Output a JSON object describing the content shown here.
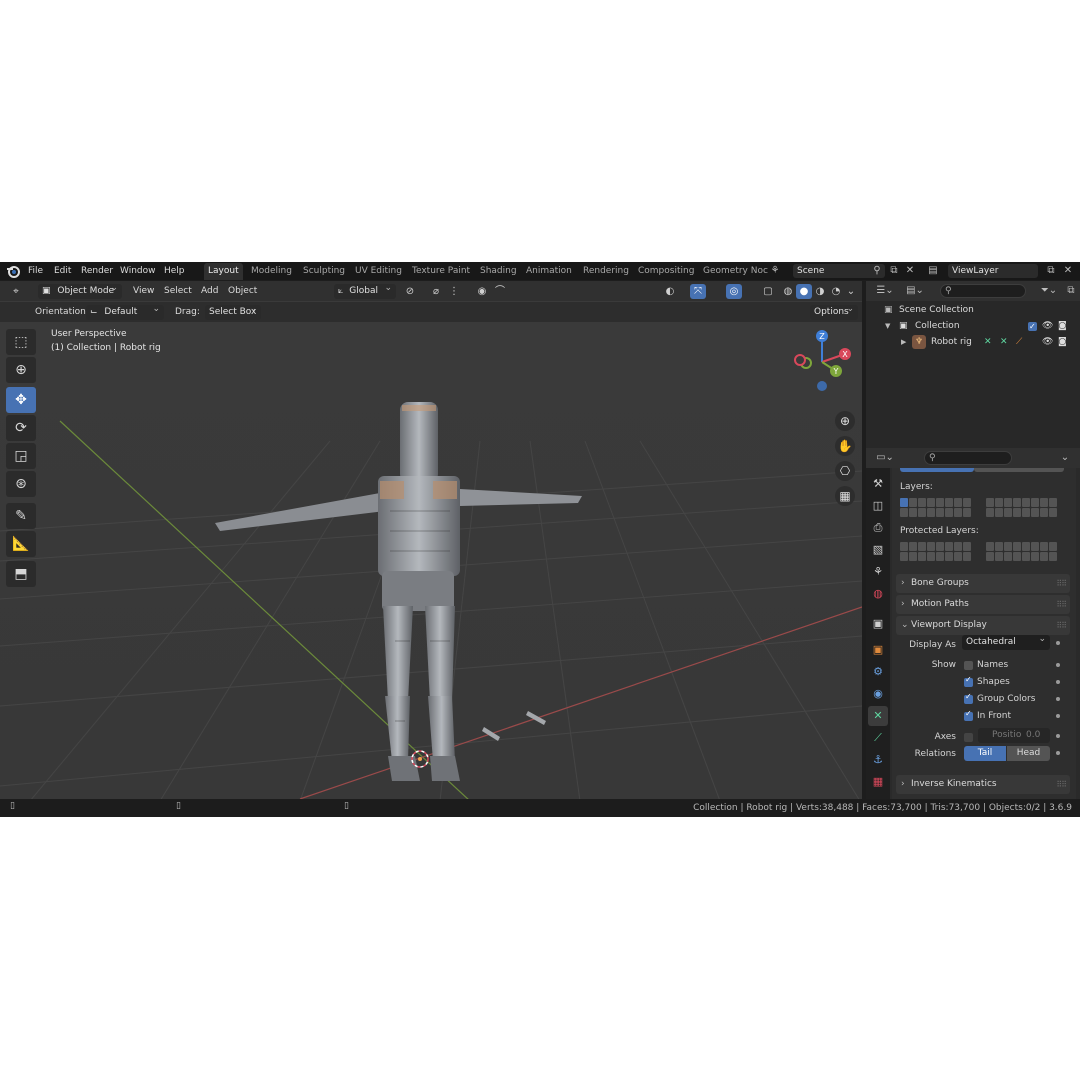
{
  "menu": {
    "items": [
      "File",
      "Edit",
      "Render",
      "Window",
      "Help"
    ]
  },
  "workspaces": {
    "tabs": [
      "Layout",
      "Modeling",
      "Sculpting",
      "UV Editing",
      "Texture Paint",
      "Shading",
      "Animation",
      "Rendering",
      "Compositing",
      "Geometry Noc"
    ],
    "active": "Layout"
  },
  "scene": {
    "name": "Scene",
    "view_layer": "ViewLayer"
  },
  "viewport_header": {
    "mode": "Object Mode",
    "menus": [
      "View",
      "Select",
      "Add",
      "Object"
    ],
    "transform": "Global"
  },
  "tool_header": {
    "orientation_label": "Orientation:",
    "orientation_value": "Default",
    "drag_label": "Drag:",
    "drag_value": "Select Box",
    "options_label": "Options"
  },
  "viewport": {
    "perspective": "User Perspective",
    "context": "(1) Collection | Robot rig",
    "gizmo": {
      "z": "Z",
      "y": "Y",
      "x": "X"
    }
  },
  "outliner": {
    "root": "Scene Collection",
    "collection": "Collection",
    "object": "Robot rig"
  },
  "properties": {
    "layers_label": "Layers:",
    "protected_layers_label": "Protected Layers:",
    "panels": {
      "bone_groups": "Bone Groups",
      "motion_paths": "Motion Paths",
      "viewport_display": "Viewport Display",
      "inverse_kinematics": "Inverse Kinematics"
    },
    "display_as_label": "Display As",
    "display_as_value": "Octahedral",
    "show_label": "Show",
    "show_options": [
      {
        "label": "Names",
        "checked": false
      },
      {
        "label": "Shapes",
        "checked": true
      },
      {
        "label": "Group Colors",
        "checked": true
      },
      {
        "label": "In Front",
        "checked": true
      }
    ],
    "axes_label": "Axes",
    "axes_position_label": "Positio",
    "axes_position_value": "0.0",
    "relations_label": "Relations",
    "relations_options": [
      "Tail",
      "Head"
    ],
    "relations_active": "Tail"
  },
  "statusbar": {
    "text": "Collection | Robot rig | Verts:38,488 | Faces:73,700 | Tris:73,700 | Objects:0/2 | 3.6.9"
  },
  "colors": {
    "accent": "#4772b3",
    "x_axis": "#d9485b",
    "y_axis": "#7ea63b",
    "z_axis": "#3f7fd8"
  }
}
